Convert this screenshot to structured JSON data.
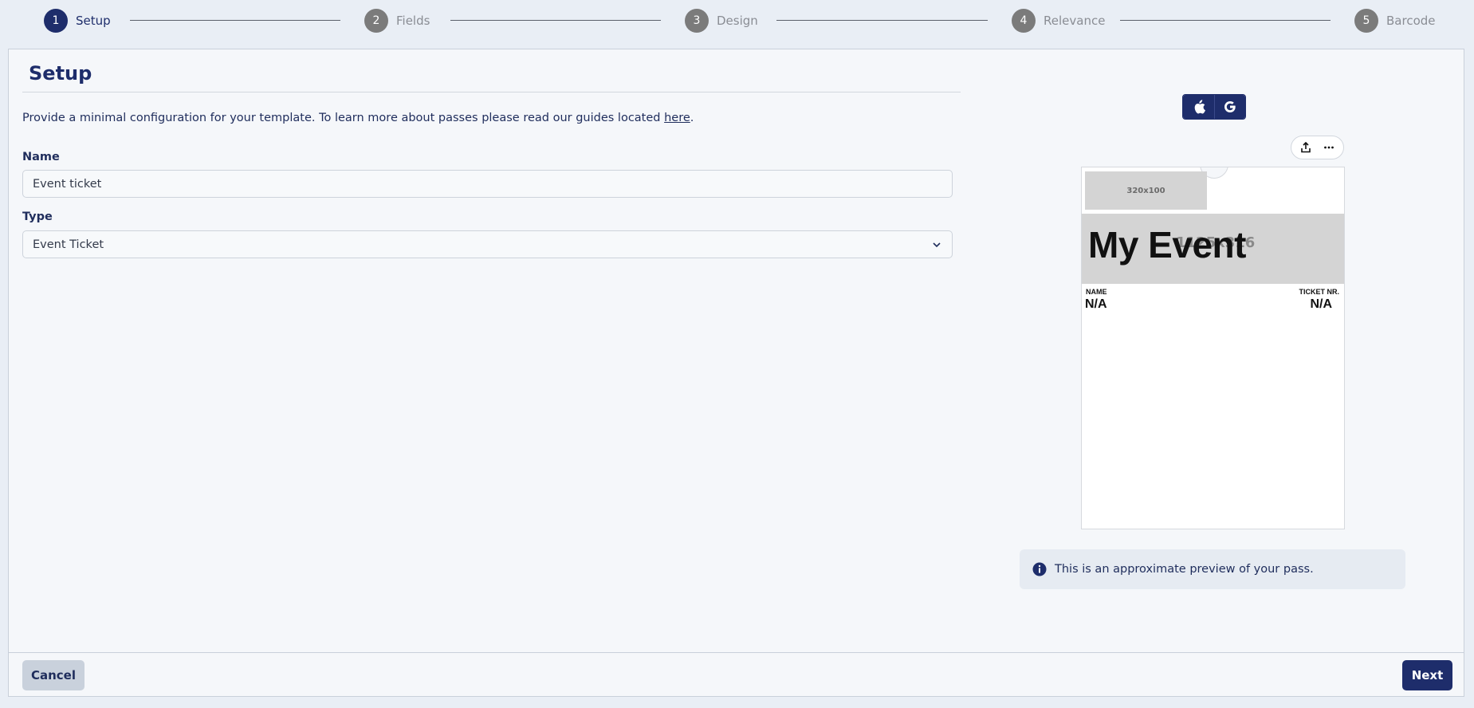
{
  "stepper": {
    "steps": [
      {
        "num": "1",
        "label": "Setup",
        "active": true
      },
      {
        "num": "2",
        "label": "Fields",
        "active": false
      },
      {
        "num": "3",
        "label": "Design",
        "active": false
      },
      {
        "num": "4",
        "label": "Relevance",
        "active": false
      },
      {
        "num": "5",
        "label": "Barcode",
        "active": false
      }
    ]
  },
  "setup": {
    "title": "Setup",
    "intro_text": "Provide a minimal configuration for your template. To learn more about passes please read our guides located ",
    "intro_link": "here",
    "intro_end": ".",
    "name_label": "Name",
    "name_value": "Event ticket",
    "type_label": "Type",
    "type_value": "Event Ticket"
  },
  "preview": {
    "platforms": [
      "apple-icon",
      "google-icon"
    ],
    "toolbar_icons": [
      "share-icon",
      "more-icon"
    ],
    "logo_placeholder": "320x100",
    "strip_placeholder": "1125x316",
    "event_title": "My Event",
    "fields": [
      {
        "label": "NAME",
        "value": "N/A"
      },
      {
        "label": "TICKET NR.",
        "value": "N/A"
      }
    ],
    "info_text": "This is an approximate preview of your pass."
  },
  "footer": {
    "cancel_label": "Cancel",
    "next_label": "Next"
  },
  "colors": {
    "primary": "#1e2d6b",
    "inactive_step": "#7b7b7b",
    "background": "#e9eef5"
  }
}
